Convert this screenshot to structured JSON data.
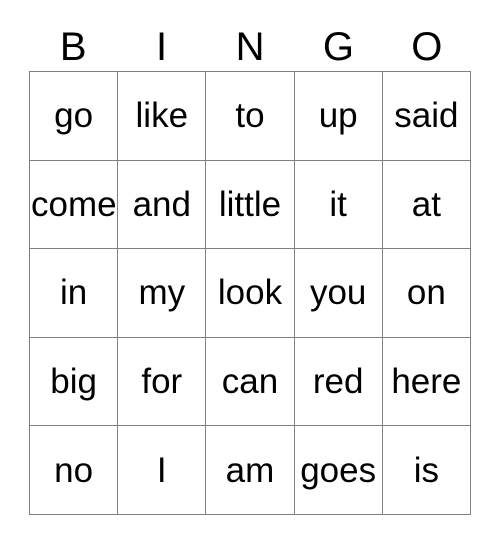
{
  "card": {
    "title": "BINGO",
    "header_letters": [
      "B",
      "I",
      "N",
      "G",
      "O"
    ],
    "grid_line_color": "#808080",
    "text_color": "#000000",
    "background_color": "#ffffff",
    "rows": [
      {
        "cells": [
          "go",
          "like",
          "to",
          "up",
          "said"
        ]
      },
      {
        "cells": [
          "come",
          "and",
          "little",
          "it",
          "at"
        ]
      },
      {
        "cells": [
          "in",
          "my",
          "look",
          "you",
          "on"
        ]
      },
      {
        "cells": [
          "big",
          "for",
          "can",
          "red",
          "here"
        ]
      },
      {
        "cells": [
          "no",
          "I",
          "am",
          "goes",
          "is"
        ]
      }
    ]
  }
}
